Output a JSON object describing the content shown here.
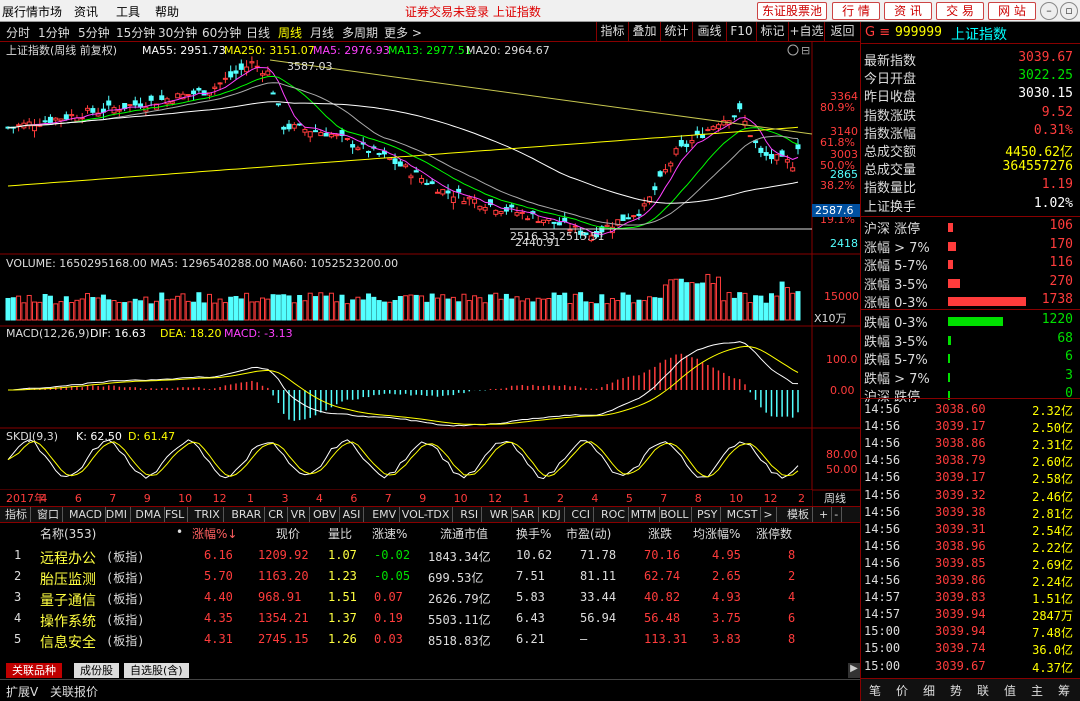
{
  "menubar": {
    "items": [
      "展行情市场",
      "资讯",
      "工具",
      "帮助"
    ],
    "status": "证券交易未登录  上证指数",
    "buttons": [
      "东证股票池",
      "行 情",
      "资 讯",
      "交 易",
      "网 站"
    ]
  },
  "periodbar": {
    "items": [
      "分时",
      "1分钟",
      "5分钟",
      "15分钟",
      "30分钟",
      "60分钟",
      "日线",
      "周线",
      "月线",
      "多周期",
      "更多 >"
    ],
    "active": "周线",
    "right_tools": [
      "指标",
      "叠加",
      "统计",
      "画线",
      "F10",
      "标记",
      "+自选",
      "返回"
    ]
  },
  "chart": {
    "main_title": "上证指数(周线 前复权)",
    "ma_labels": [
      {
        "text": "MA55: 2951.73",
        "color": "#ffffff"
      },
      {
        "text": "MA250: 3151.07",
        "color": "#ffff00"
      },
      {
        "text": "MA5: 2976.93",
        "color": "#ff40ff"
      },
      {
        "text": "MA13: 2977.51",
        "color": "#00ff00"
      },
      {
        "text": "MA20: 2964.67",
        "color": "#dddddd"
      }
    ],
    "price_ticks": [
      "3364",
      "3140",
      "3003",
      "2865",
      "2418"
    ],
    "pct_ticks": [
      "80.9%",
      "61.8%",
      "50.0%",
      "38.2%",
      "19.1%"
    ],
    "high_label": "3587.03",
    "low_label": "2516.33  2515.51",
    "low_label2": "2440.91",
    "last_price_tag": "2587.6",
    "volume_title": "VOLUME: 1650295168.00  MA5: 1296540288.00  MA60: 1052523200.00",
    "volume_tick": "15000",
    "volume_unit": "X10万",
    "macd_title": "MACD(12,26,9)",
    "macd_dif": "DIF: 16.63",
    "macd_dea": "DEA: 18.20",
    "macd_macd": "MACD: -3.13",
    "macd_ticks": [
      "100.0",
      "0.00"
    ],
    "kdj_title": "SKDJ(9,3)",
    "kdj_k": "K: 62.50",
    "kdj_d": "D: 61.47",
    "kdj_ticks": [
      "80.00",
      "50.00"
    ],
    "date_axis": [
      "2017年",
      "4",
      "6",
      "7",
      "9",
      "10",
      "12",
      "1",
      "3",
      "4",
      "6",
      "7",
      "9",
      "10",
      "12",
      "1",
      "2",
      "4",
      "5",
      "7",
      "8",
      "10",
      "12",
      "2"
    ],
    "period_tag": "周线",
    "colors": {
      "up": "#ff3c3c",
      "down": "#54ffff",
      "ma250": "#ffff00",
      "ma55": "#ffffff",
      "ma5": "#ff40ff",
      "ma13": "#00ff00"
    }
  },
  "bottom_tabs": [
    "指标",
    "窗口",
    "MACD",
    "DMI",
    "DMA",
    "FSL",
    "TRIX",
    "BRAR",
    "CR",
    "VR",
    "OBV",
    "ASI",
    "EMV",
    "VOL-TDX",
    "RSI",
    "WR",
    "SAR",
    "KDJ",
    "CCI",
    "ROC",
    "MTM",
    "BOLL",
    "PSY",
    "MCST",
    ">",
    "模板",
    "+",
    "-"
  ],
  "table": {
    "headers": [
      "名称(353)",
      "•",
      "涨幅%↓",
      "现价",
      "量比",
      "涨速%",
      "流通市值",
      "换手%",
      "市盈(动)",
      "涨跌",
      "均涨幅%",
      "涨停数"
    ],
    "rows": [
      {
        "idx": "1",
        "name": "远程办公",
        "tag": "(板指)",
        "chg": "6.16",
        "price": "1209.92",
        "vr": "1.07",
        "speed": "-0.02",
        "cap": "1843.34亿",
        "turn": "10.62",
        "pe": "71.78",
        "diff": "70.16",
        "avg": "4.95",
        "lim": "8"
      },
      {
        "idx": "2",
        "name": "胎压监测",
        "tag": "(板指)",
        "chg": "5.70",
        "price": "1163.20",
        "vr": "1.23",
        "speed": "-0.05",
        "cap": "699.53亿",
        "turn": "7.51",
        "pe": "81.11",
        "diff": "62.74",
        "avg": "2.65",
        "lim": "2"
      },
      {
        "idx": "3",
        "name": "量子通信",
        "tag": "(板指)",
        "chg": "4.40",
        "price": "968.91",
        "vr": "1.51",
        "speed": "0.07",
        "cap": "2626.79亿",
        "turn": "5.83",
        "pe": "33.44",
        "diff": "40.82",
        "avg": "4.93",
        "lim": "4"
      },
      {
        "idx": "4",
        "name": "操作系统",
        "tag": "(板指)",
        "chg": "4.35",
        "price": "1354.21",
        "vr": "1.37",
        "speed": "0.19",
        "cap": "5503.11亿",
        "turn": "6.43",
        "pe": "56.94",
        "diff": "56.48",
        "avg": "3.75",
        "lim": "6"
      },
      {
        "idx": "5",
        "name": "信息安全",
        "tag": "(板指)",
        "chg": "4.31",
        "price": "2745.15",
        "vr": "1.26",
        "speed": "0.03",
        "cap": "8518.83亿",
        "turn": "6.21",
        "pe": "–",
        "diff": "113.31",
        "avg": "3.83",
        "lim": "8"
      }
    ]
  },
  "sheettabs": [
    "关联品种",
    "成份股",
    "自选股(含)"
  ],
  "statusbar": [
    "扩展V",
    "关联报价"
  ],
  "right": {
    "code_prefix": "G ≡",
    "code": "999999",
    "name": "上证指数",
    "quote": [
      {
        "label": "最新指数",
        "value": "3039.67",
        "color": "red"
      },
      {
        "label": "今日开盘",
        "value": "3022.25",
        "color": "green"
      },
      {
        "label": "昨日收盘",
        "value": "3030.15",
        "color": "white"
      },
      {
        "label": "指数涨跌",
        "value": "9.52",
        "color": "red"
      },
      {
        "label": "指数涨幅",
        "value": "0.31%",
        "color": "red"
      },
      {
        "label": "总成交额",
        "value": "4450.62亿",
        "color": "yellow"
      },
      {
        "label": "总成交量",
        "value": "364557276",
        "color": "yellow"
      },
      {
        "label": "指数量比",
        "value": "1.19",
        "color": "red"
      },
      {
        "label": "上证换手",
        "value": "1.02%",
        "color": "white"
      }
    ],
    "breadth_up": [
      {
        "label": "沪深 涨停",
        "value": "106",
        "frac": 0.06
      },
      {
        "label": "涨幅 > 7%",
        "value": "170",
        "frac": 0.1
      },
      {
        "label": "涨幅 5-7%",
        "value": "116",
        "frac": 0.07
      },
      {
        "label": "涨幅 3-5%",
        "value": "270",
        "frac": 0.16
      },
      {
        "label": "涨幅 0-3%",
        "value": "1738",
        "frac": 1.0
      }
    ],
    "breadth_down": [
      {
        "label": "跌幅 0-3%",
        "value": "1220",
        "frac": 0.7
      },
      {
        "label": "跌幅 3-5%",
        "value": "68",
        "frac": 0.04
      },
      {
        "label": "跌幅 5-7%",
        "value": "6",
        "frac": 0.01
      },
      {
        "label": "跌幅 > 7%",
        "value": "3",
        "frac": 0.01
      },
      {
        "label": "沪深 跌停",
        "value": "0",
        "frac": 0.0
      }
    ],
    "ticks": [
      {
        "t": "14:56",
        "p": "3038.60",
        "v": "2.32亿"
      },
      {
        "t": "14:56",
        "p": "3039.17",
        "v": "2.50亿"
      },
      {
        "t": "14:56",
        "p": "3038.86",
        "v": "2.31亿"
      },
      {
        "t": "14:56",
        "p": "3038.79",
        "v": "2.60亿"
      },
      {
        "t": "14:56",
        "p": "3039.17",
        "v": "2.58亿"
      },
      {
        "t": "14:56",
        "p": "3039.32",
        "v": "2.46亿"
      },
      {
        "t": "14:56",
        "p": "3039.38",
        "v": "2.81亿"
      },
      {
        "t": "14:56",
        "p": "3039.31",
        "v": "2.54亿"
      },
      {
        "t": "14:56",
        "p": "3038.96",
        "v": "2.22亿"
      },
      {
        "t": "14:56",
        "p": "3039.85",
        "v": "2.69亿"
      },
      {
        "t": "14:56",
        "p": "3039.86",
        "v": "2.24亿"
      },
      {
        "t": "14:57",
        "p": "3039.83",
        "v": "1.51亿"
      },
      {
        "t": "14:57",
        "p": "3039.94",
        "v": "2847万"
      },
      {
        "t": "15:00",
        "p": "3039.94",
        "v": "7.48亿"
      },
      {
        "t": "15:00",
        "p": "3039.74",
        "v": "36.0亿"
      },
      {
        "t": "15:00",
        "p": "3039.67",
        "v": "4.37亿"
      }
    ],
    "footer": [
      "笔",
      "价",
      "细",
      "势",
      "联",
      "值",
      "主",
      "筹"
    ]
  }
}
